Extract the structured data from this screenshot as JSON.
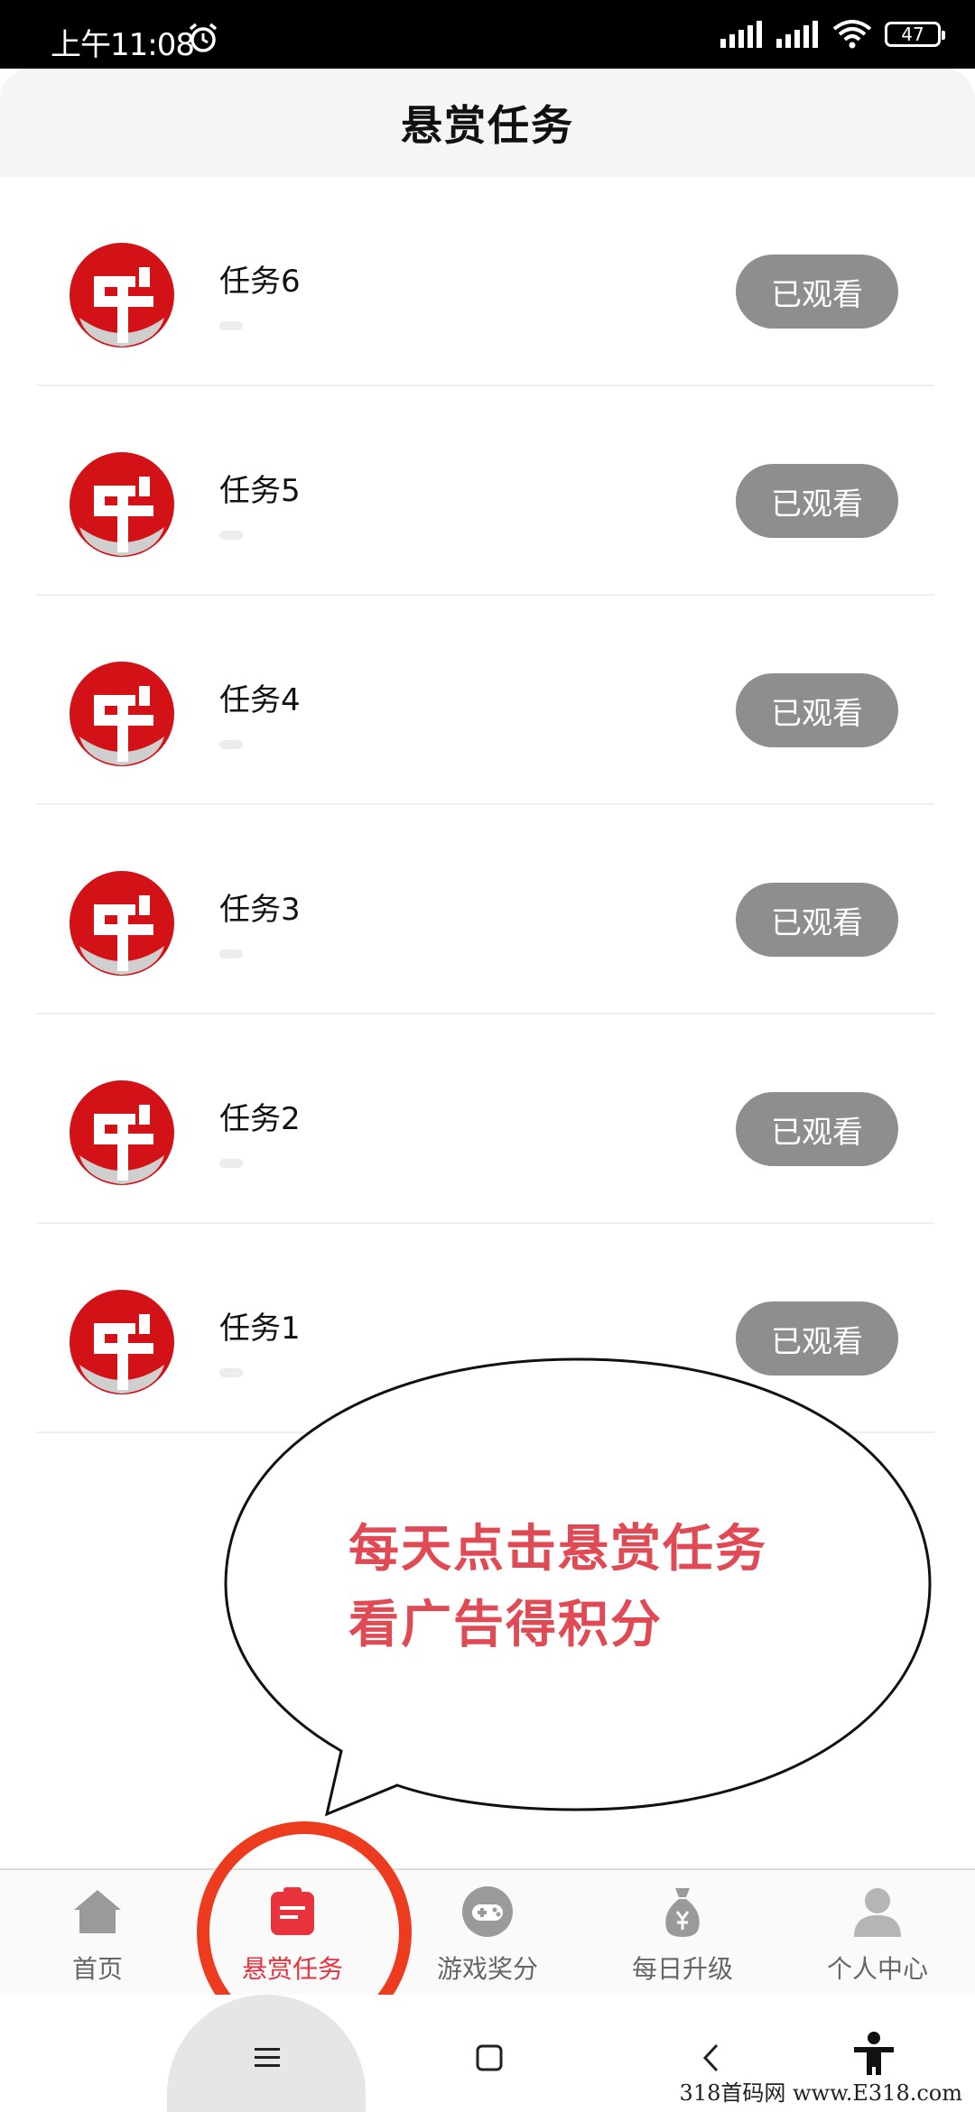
{
  "status_bar": {
    "time": "上午11:08",
    "battery": "47"
  },
  "header": {
    "title": "悬赏任务"
  },
  "tasks": [
    {
      "name": "任务6",
      "status": "已观看"
    },
    {
      "name": "任务5",
      "status": "已观看"
    },
    {
      "name": "任务4",
      "status": "已观看"
    },
    {
      "name": "任务3",
      "status": "已观看"
    },
    {
      "name": "任务2",
      "status": "已观看"
    },
    {
      "name": "任务1",
      "status": "已观看"
    }
  ],
  "callout": {
    "line1": "每天点击悬赏任务",
    "line2": "看广告得积分"
  },
  "tabbar": {
    "items": [
      {
        "label": "首页",
        "icon": "home-icon"
      },
      {
        "label": "悬赏任务",
        "icon": "task-list-icon",
        "active": true
      },
      {
        "label": "游戏奖分",
        "icon": "gamepad-icon"
      },
      {
        "label": "每日升级",
        "icon": "money-bag-icon"
      },
      {
        "label": "个人中心",
        "icon": "user-icon"
      }
    ]
  },
  "watermark": "318首码网 www.E318.com",
  "colors": {
    "accent": "#e8333d",
    "button_gray": "#8e8e8e",
    "callout_text": "#e04a54",
    "annotation_circle": "#ec3b1f"
  }
}
